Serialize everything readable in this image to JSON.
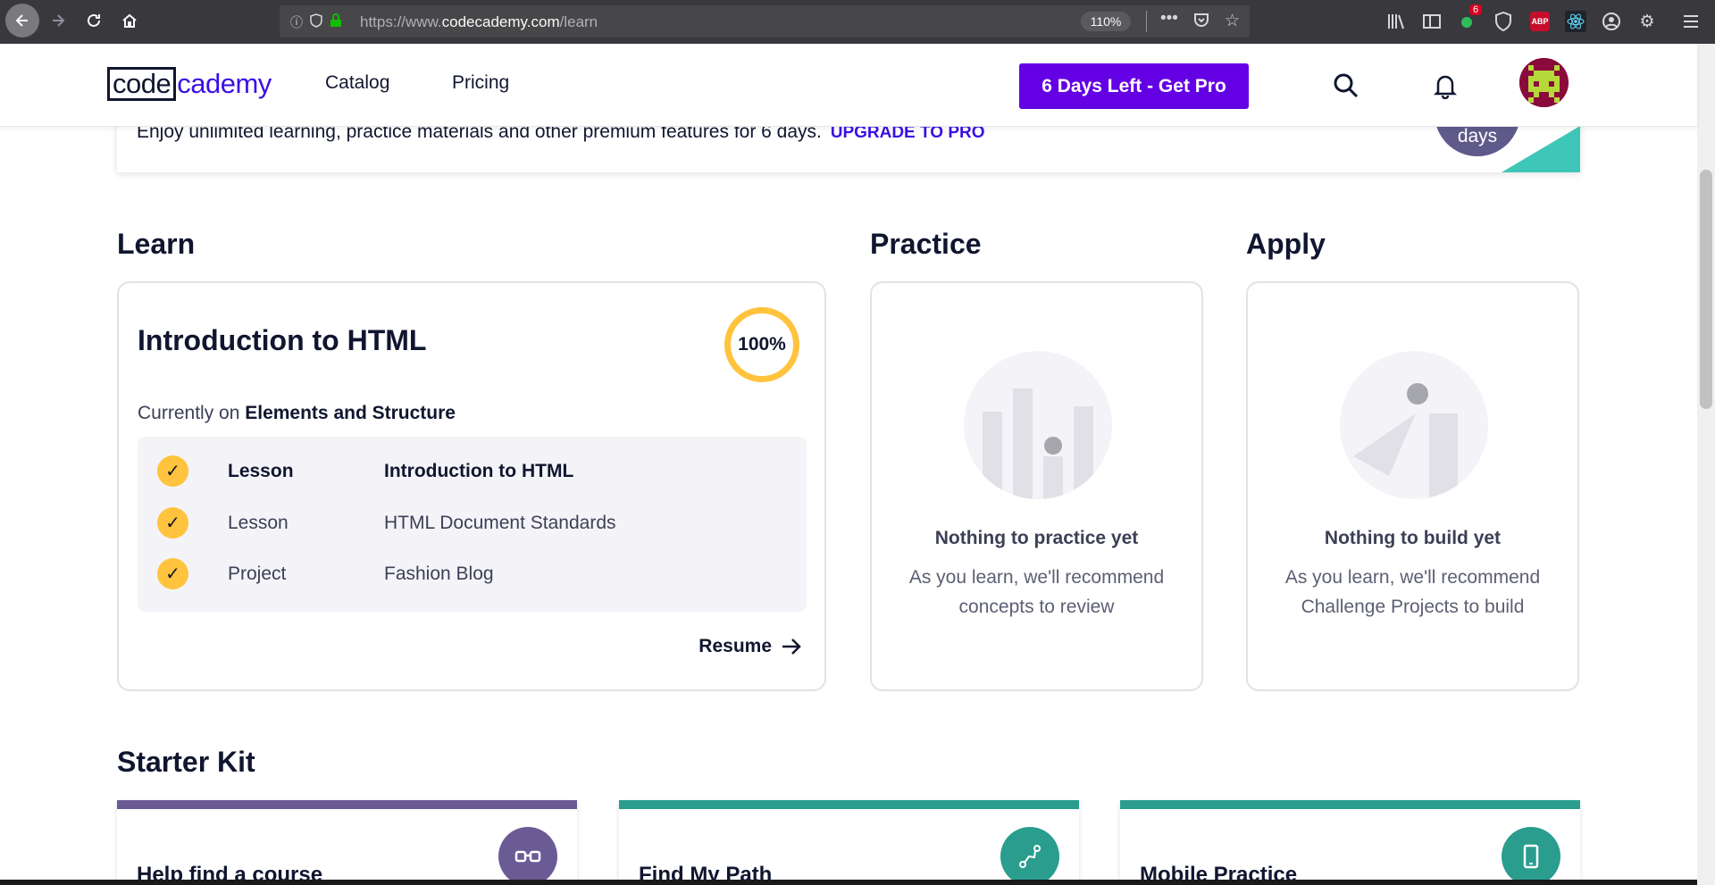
{
  "browser": {
    "url_prefix": "https://www.",
    "url_domain": "codecademy.com",
    "url_path": "/learn",
    "zoom": "110%",
    "notification_badge": "6",
    "abp_label": "ABP"
  },
  "header": {
    "logo_box": "code",
    "logo_rest": "cademy",
    "nav": [
      "Catalog",
      "Pricing"
    ],
    "cta": "6 Days Left - Get Pro"
  },
  "banner": {
    "text": "Enjoy unlimited learning, practice materials and other premium features for 6 days.",
    "link": "UPGRADE TO PRO",
    "days": "days"
  },
  "learn": {
    "title": "Learn",
    "course": "Introduction to HTML",
    "progress": "100%",
    "currently_prefix": "Currently on",
    "currently_module": "Elements and Structure",
    "items": [
      {
        "type": "Lesson",
        "name": "Introduction to HTML"
      },
      {
        "type": "Lesson",
        "name": "HTML Document Standards"
      },
      {
        "type": "Project",
        "name": "Fashion Blog"
      }
    ],
    "resume": "Resume"
  },
  "practice": {
    "title": "Practice",
    "empty_title": "Nothing to practice yet",
    "empty_desc": "As you learn, we'll recommend concepts to review"
  },
  "apply": {
    "title": "Apply",
    "empty_title": "Nothing to build yet",
    "empty_desc": "As you learn, we'll recommend Challenge Projects to build"
  },
  "starter_kit": {
    "title": "Starter Kit",
    "cards": [
      {
        "title": "Help find a course",
        "color": "#6b5b95",
        "icon": "glasses-icon"
      },
      {
        "title": "Find My Path",
        "color": "#2a9d8f",
        "icon": "path-icon"
      },
      {
        "title": "Mobile Practice",
        "color": "#2a9d8f",
        "icon": "mobile-icon"
      }
    ]
  },
  "colors": {
    "brand_purple": "#6400e4",
    "progress_yellow": "#ffc33d",
    "link_blue": "#3a10e5"
  }
}
